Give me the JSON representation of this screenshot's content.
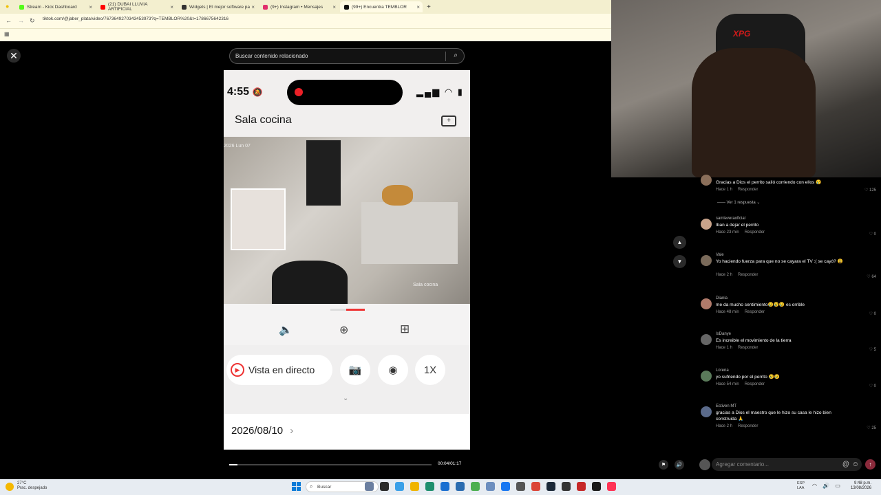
{
  "browser": {
    "tabs": [
      {
        "title": "Stream - Kick Dashboard",
        "color": "#53fc18"
      },
      {
        "title": "(21) DUBAI LLUVIA ARTIFICIAL",
        "color": "#ff0000"
      },
      {
        "title": "Widgets | El mejor software pa",
        "color": "#333333"
      },
      {
        "title": "(9+) Instagram • Mensajes",
        "color": "#e1306c"
      },
      {
        "title": "(99+) Encuentra TEMBLOR",
        "color": "#111111"
      }
    ],
    "new_tab": "+",
    "url": "tiktok.com/@jaber_plata/video/7673649270343453973?q=TEMBLOR%20&t=1786675642316"
  },
  "search": {
    "placeholder": "Buscar contenido relacionado",
    "icon": "search-icon"
  },
  "close": {
    "icon": "close-icon",
    "glyph": "✕"
  },
  "video": {
    "phone_time": "4:55",
    "camera_title": "Sala cocina",
    "cam_overlay_date": "2026 Lun 07",
    "cam_overlay_label": "Sala cocina",
    "live_label": "Vista en directo",
    "speed_label": "1X",
    "date": "2026/08/10",
    "time_display": "00:04/01:17",
    "progress": 0.04
  },
  "comments": [
    {
      "user": "",
      "text": "Gracias a Dios el perrito salió corriendo con ellos 😢",
      "time": "Hace 1 h",
      "reply": "Responder",
      "likes": "125",
      "avatar_color": "#8b6f5a"
    },
    {
      "user": "samleveraoficial",
      "text": "Iban a dejar el perrito",
      "time": "Hace 23 min",
      "reply": "Responder",
      "likes": "0",
      "avatar_color": "#c9a38a"
    },
    {
      "user": "Vale",
      "text": "Yo haciendo fuerza para que no se cayara el TV :( se cayó? 😩",
      "time": "Hace 2 h",
      "reply": "Responder",
      "likes": "64",
      "avatar_color": "#7a6a5a"
    },
    {
      "user": "Diania",
      "text": "me da mucho sentimiento😢😢😢 es orrible",
      "time": "Hace 48 min",
      "reply": "Responder",
      "likes": "0",
      "avatar_color": "#b07a6a"
    },
    {
      "user": "IsDanye",
      "text": "Es increible el movimiento de la tierra",
      "time": "Hace 1 h",
      "reply": "Responder",
      "likes": "5",
      "avatar_color": "#666666"
    },
    {
      "user": "Lorena",
      "text": "yo sufriendo por el perrito 😢😢",
      "time": "Hace 54 min",
      "reply": "Responder",
      "likes": "0",
      "avatar_color": "#5a7a5a"
    },
    {
      "user": "Estiven MT",
      "text": "gracias a Dios el maestro que le hizo su casa le hizo bien construida 🙏",
      "time": "Hace 2 h",
      "reply": "Responder",
      "likes": "25",
      "avatar_color": "#5a6a8a"
    }
  ],
  "replies_toggle": "Ver 1 respuesta",
  "comment_input": {
    "placeholder": "Agregar comentario..."
  },
  "taskbar": {
    "weather_temp": "27°C",
    "weather_desc": "Prac. despejado",
    "search_label": "Buscar",
    "lang1": "ESP",
    "lang2": "LAA",
    "time": "9:48 p.m.",
    "date": "13/08/2026"
  },
  "webcam": {
    "chair_logo": "XPG"
  }
}
